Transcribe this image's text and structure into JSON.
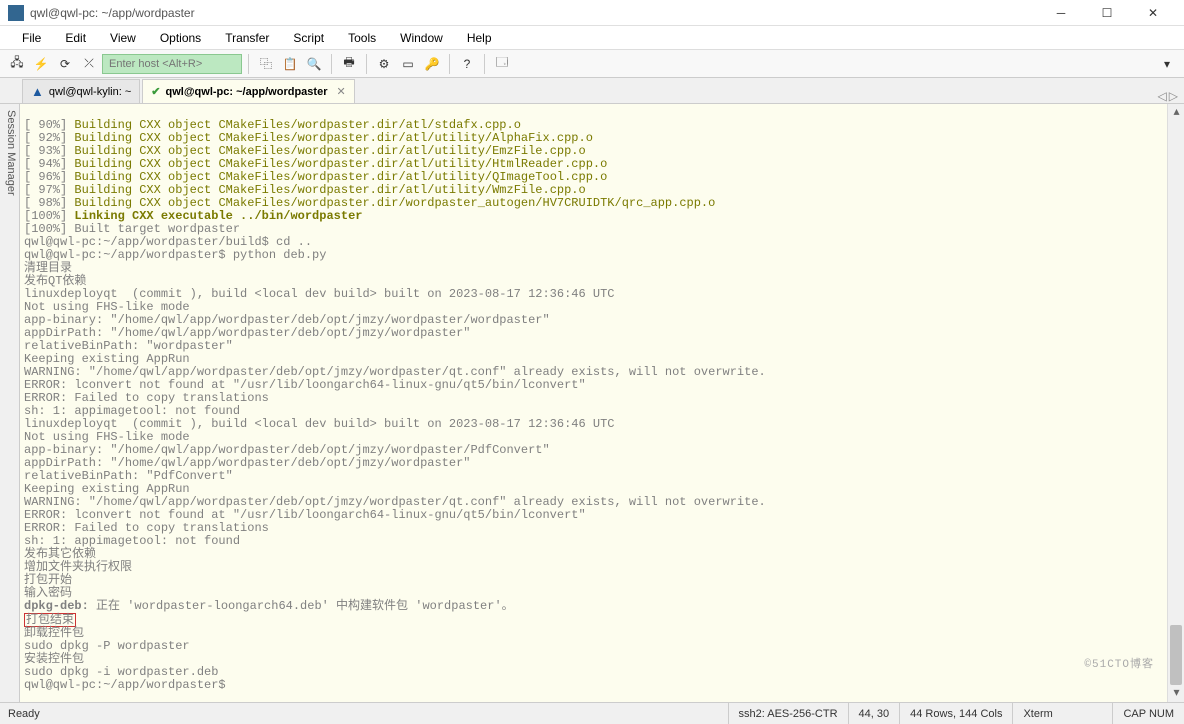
{
  "window": {
    "title": "qwl@qwl-pc: ~/app/wordpaster"
  },
  "menu": [
    "File",
    "Edit",
    "View",
    "Options",
    "Transfer",
    "Script",
    "Tools",
    "Window",
    "Help"
  ],
  "toolbar": {
    "host_placeholder": "Enter host <Alt+R>"
  },
  "tabs": [
    {
      "label": "qwl@qwl-kylin: ~",
      "active": false
    },
    {
      "label": "qwl@qwl-pc: ~/app/wordpaster",
      "active": true
    }
  ],
  "sidebar": {
    "label": "Session Manager"
  },
  "term": {
    "b1p": "[ 90%] ",
    "b1": "Building CXX object CMakeFiles/wordpaster.dir/atl/stdafx.cpp.o",
    "b2p": "[ 92%] ",
    "b2": "Building CXX object CMakeFiles/wordpaster.dir/atl/utility/AlphaFix.cpp.o",
    "b3p": "[ 93%] ",
    "b3": "Building CXX object CMakeFiles/wordpaster.dir/atl/utility/EmzFile.cpp.o",
    "b4p": "[ 94%] ",
    "b4": "Building CXX object CMakeFiles/wordpaster.dir/atl/utility/HtmlReader.cpp.o",
    "b5p": "[ 96%] ",
    "b5": "Building CXX object CMakeFiles/wordpaster.dir/atl/utility/QImageTool.cpp.o",
    "b6p": "[ 97%] ",
    "b6": "Building CXX object CMakeFiles/wordpaster.dir/atl/utility/WmzFile.cpp.o",
    "b7p": "[ 98%] ",
    "b7": "Building CXX object CMakeFiles/wordpaster.dir/wordpaster_autogen/HV7CRUIDTK/qrc_app.cpp.o",
    "b8p": "[100%] ",
    "b8": "Linking CXX executable ../bin/wordpaster",
    "b9": "[100%] Built target wordpaster",
    "l10": "qwl@qwl-pc:~/app/wordpaster/build$ cd ..",
    "l11": "qwl@qwl-pc:~/app/wordpaster$ python deb.py",
    "l12": "清理目录",
    "l13": "发布QT依赖",
    "l14": "linuxdeployqt  (commit ), build <local dev build> built on 2023-08-17 12:36:46 UTC",
    "l15": "Not using FHS-like mode",
    "l16": "app-binary: \"/home/qwl/app/wordpaster/deb/opt/jmzy/wordpaster/wordpaster\"",
    "l17": "appDirPath: \"/home/qwl/app/wordpaster/deb/opt/jmzy/wordpaster\"",
    "l18": "relativeBinPath: \"wordpaster\"",
    "l19": "Keeping existing AppRun",
    "l20": "WARNING: \"/home/qwl/app/wordpaster/deb/opt/jmzy/wordpaster/qt.conf\" already exists, will not overwrite.",
    "l21": "ERROR: lconvert not found at \"/usr/lib/loongarch64-linux-gnu/qt5/bin/lconvert\"",
    "l22": "ERROR: Failed to copy translations",
    "l23": "sh: 1: appimagetool: not found",
    "l24": "linuxdeployqt  (commit ), build <local dev build> built on 2023-08-17 12:36:46 UTC",
    "l25": "Not using FHS-like mode",
    "l26": "app-binary: \"/home/qwl/app/wordpaster/deb/opt/jmzy/wordpaster/PdfConvert\"",
    "l27": "appDirPath: \"/home/qwl/app/wordpaster/deb/opt/jmzy/wordpaster\"",
    "l28": "relativeBinPath: \"PdfConvert\"",
    "l29": "Keeping existing AppRun",
    "l30": "WARNING: \"/home/qwl/app/wordpaster/deb/opt/jmzy/wordpaster/qt.conf\" already exists, will not overwrite.",
    "l31": "ERROR: lconvert not found at \"/usr/lib/loongarch64-linux-gnu/qt5/bin/lconvert\"",
    "l32": "ERROR: Failed to copy translations",
    "l33": "sh: 1: appimagetool: not found",
    "l34": "发布其它依赖",
    "l35": "增加文件夹执行权限",
    "l36": "打包开始",
    "l37": "输入密码",
    "l38a": "dpkg-deb:",
    "l38b": " 正在 'wordpaster-loongarch64.deb' 中构建软件包 'wordpaster'。",
    "l39": "打包结束",
    "l40": "卸载控件包",
    "l41": "sudo dpkg -P wordpaster",
    "l42": "安装控件包",
    "l43": "sudo dpkg -i wordpaster.deb",
    "l44": "qwl@qwl-pc:~/app/wordpaster$ "
  },
  "status": {
    "ready": "Ready",
    "conn": "ssh2: AES-256-CTR",
    "pos": "44,   30",
    "size": "44 Rows, 144 Cols",
    "term": "Xterm",
    "caps": "CAP  NUM"
  },
  "watermark": "©51CTO博客"
}
